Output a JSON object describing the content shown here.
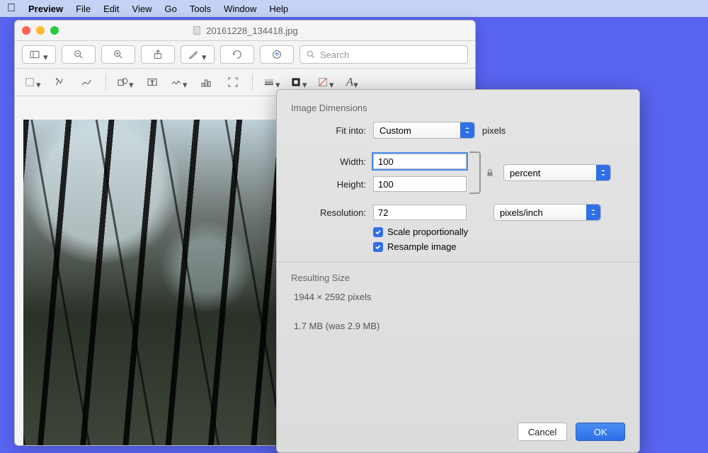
{
  "menubar": {
    "app": "Preview",
    "items": [
      "File",
      "Edit",
      "View",
      "Go",
      "Tools",
      "Window",
      "Help"
    ]
  },
  "window": {
    "title": "20161228_134418.jpg"
  },
  "search": {
    "placeholder": "Search"
  },
  "dialog": {
    "section1": "Image Dimensions",
    "fit_label": "Fit into:",
    "fit_value": "Custom",
    "fit_unit": "pixels",
    "width_label": "Width:",
    "width_value": "100",
    "height_label": "Height:",
    "height_value": "100",
    "wh_unit": "percent",
    "res_label": "Resolution:",
    "res_value": "72",
    "res_unit": "pixels/inch",
    "scale_label": "Scale proportionally",
    "resample_label": "Resample image",
    "section2": "Resulting Size",
    "result_dims": "1944 × 2592 pixels",
    "result_size": "1.7 MB (was 2.9 MB)",
    "cancel": "Cancel",
    "ok": "OK"
  }
}
